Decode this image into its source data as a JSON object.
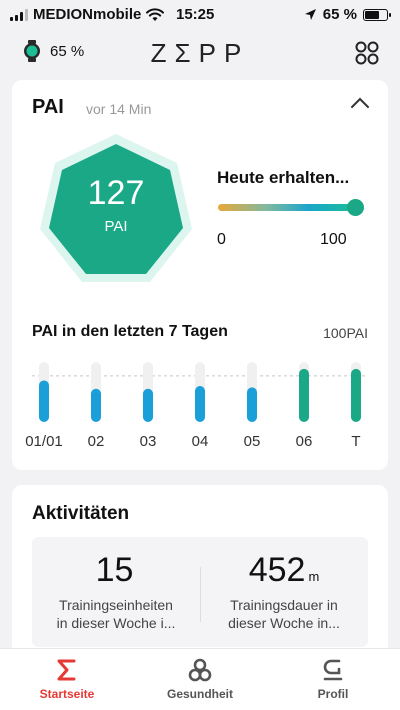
{
  "status_bar": {
    "carrier": "MEDIONmobile",
    "time": "15:25",
    "battery": "65 %",
    "icons": [
      "signal-icon",
      "wifi-icon",
      "location-arrow-icon",
      "battery-icon"
    ]
  },
  "header": {
    "watch_battery": "65 %",
    "brand": "ZΣPP",
    "icons": [
      "watch-icon",
      "apps-grid-icon"
    ]
  },
  "pai_card": {
    "title": "PAI",
    "updated": "vor 14 Min",
    "value": "127",
    "unit": "PAI",
    "today_label": "Heute erhalten...",
    "today_min": "0",
    "today_max": "100",
    "today_fraction": 1.0,
    "week_title": "PAI in den letzten 7 Tagen",
    "week_max_label": "100PAI",
    "colors": {
      "teal": "#1aa887",
      "blue": "#1a9fd8",
      "track": "#eeeeee"
    }
  },
  "chart_data": {
    "type": "bar",
    "categories": [
      "01/01",
      "02",
      "03",
      "04",
      "05",
      "06",
      "T"
    ],
    "values": [
      90,
      72,
      72,
      78,
      75,
      115,
      115
    ],
    "ylim": [
      0,
      130
    ],
    "reference_line": 100,
    "reference_label": "100PAI",
    "series_colors": [
      "#1a9fd8",
      "#1a9fd8",
      "#1a9fd8",
      "#1a9fd8",
      "#1a9fd8",
      "#1aa887",
      "#1aa887"
    ]
  },
  "activities": {
    "title": "Aktivitäten",
    "items": [
      {
        "value": "15",
        "unit": "",
        "desc_line1": "Trainingseinheiten",
        "desc_line2": "in dieser Woche i..."
      },
      {
        "value": "452",
        "unit": "m",
        "desc_line1": "Trainingsdauer in",
        "desc_line2": "dieser Woche in..."
      }
    ]
  },
  "nav": {
    "items": [
      {
        "label": "Startseite",
        "icon": "sigma-icon",
        "active": true
      },
      {
        "label": "Gesundheit",
        "icon": "health-icon",
        "active": false
      },
      {
        "label": "Profil",
        "icon": "profile-icon",
        "active": false
      }
    ],
    "active_color": "#e53935"
  }
}
